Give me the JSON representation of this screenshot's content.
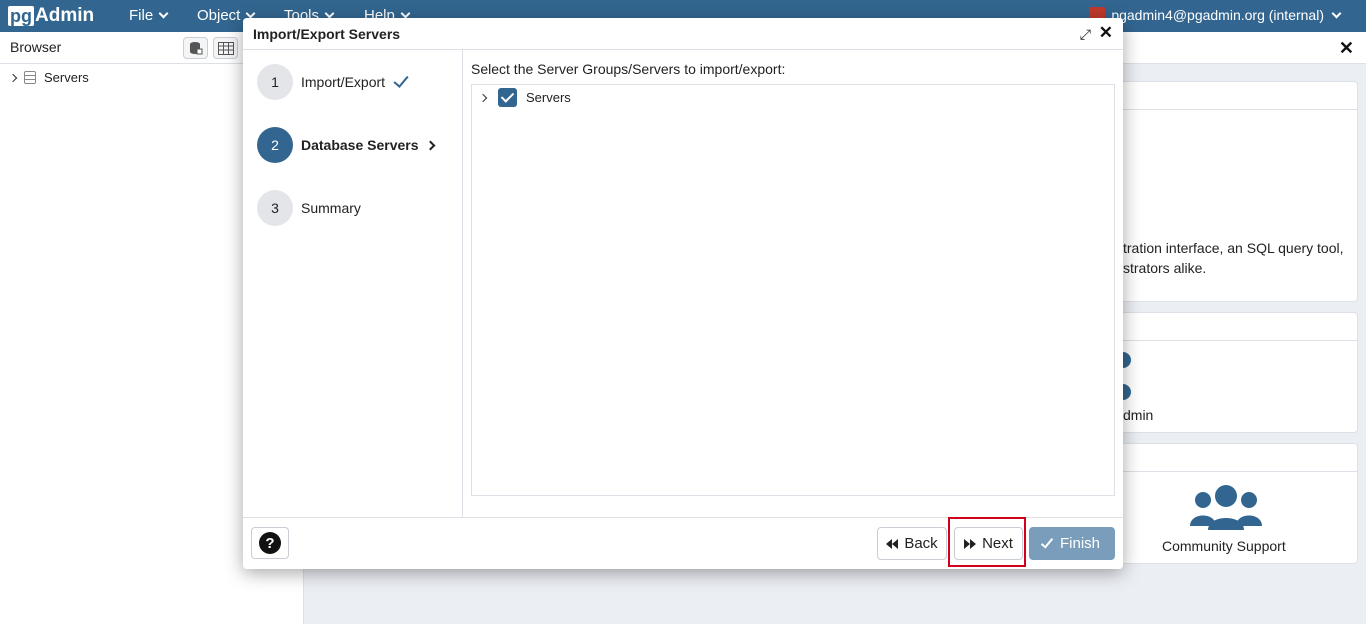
{
  "app": {
    "logo_pg": "pg",
    "logo_admin": "Admin",
    "menus": [
      "File",
      "Object",
      "Tools",
      "Help"
    ],
    "user": "pgadmin4@pgadmin.org (internal)"
  },
  "browser": {
    "title": "Browser",
    "tree": [
      {
        "label": "Servers"
      }
    ]
  },
  "dashboard": {
    "welcome_line1": "tration interface, an SQL query tool,",
    "welcome_line2": "strators alike.",
    "config_text": "dmin",
    "community_label": "Community Support"
  },
  "dialog": {
    "title": "Import/Export Servers",
    "steps": [
      {
        "number": "1",
        "label": "Import/Export",
        "state": "complete"
      },
      {
        "number": "2",
        "label": "Database Servers",
        "state": "active"
      },
      {
        "number": "3",
        "label": "Summary",
        "state": "pending"
      }
    ],
    "content_label": "Select the Server Groups/Servers to import/export:",
    "tree_item": {
      "label": "Servers",
      "checked": true
    },
    "buttons": {
      "back": "Back",
      "next": "Next",
      "finish": "Finish"
    }
  },
  "colors": {
    "brand": "#326690",
    "highlight": "#d0021b",
    "finish_disabled": "#7a9dbb"
  }
}
